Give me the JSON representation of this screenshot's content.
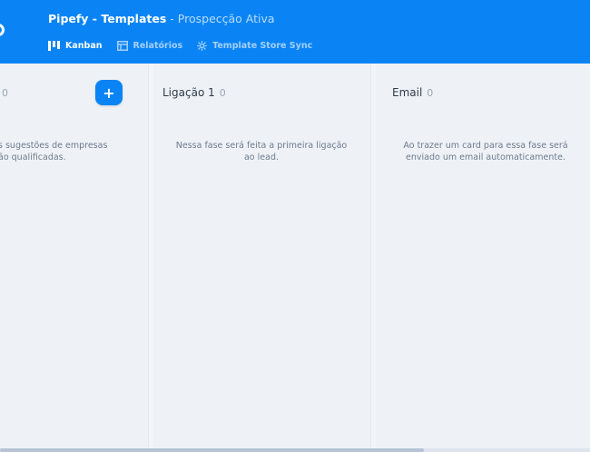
{
  "header": {
    "app_title": "Pipefy - Templates",
    "separator": "-",
    "pipe_name": "Prospecção Ativa",
    "tabs": [
      {
        "label": "Kanban",
        "icon": "kanban-icon",
        "active": true
      },
      {
        "label": "Relatórios",
        "icon": "report-icon",
        "active": false
      },
      {
        "label": "Template Store Sync",
        "icon": "gear-icon",
        "active": false
      }
    ]
  },
  "phases": [
    {
      "name": "",
      "count": "0",
      "desc_line1": "s sugestões de empresas",
      "desc_line2": "ão qualificadas."
    },
    {
      "name": "Ligação 1",
      "count": "0",
      "desc_line1": "Nessa fase será feita a primeira ligação",
      "desc_line2": "ao lead."
    },
    {
      "name": "Email",
      "count": "0",
      "desc_line1": "Ao trazer um card para essa fase será",
      "desc_line2": "enviado um email automaticamente."
    }
  ],
  "add_button_label": "+",
  "colors": {
    "brand": "#0a84f5",
    "background": "#eef2f7"
  }
}
